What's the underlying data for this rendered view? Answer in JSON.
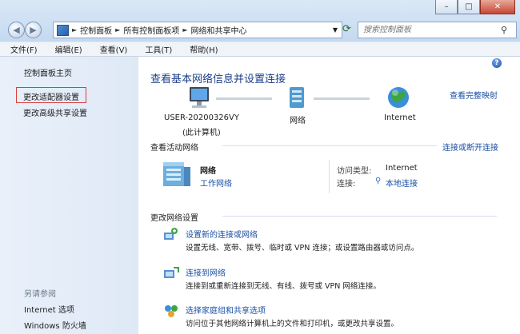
{
  "address": {
    "segments": [
      "控制面板",
      "所有控制面板项",
      "网络和共享中心"
    ]
  },
  "search": {
    "placeholder": "搜索控制面板"
  },
  "menu": [
    {
      "label": "文件(F)"
    },
    {
      "label": "编辑(E)"
    },
    {
      "label": "查看(V)"
    },
    {
      "label": "工具(T)"
    },
    {
      "label": "帮助(H)"
    }
  ],
  "sidebar": {
    "home": "控制面板主页",
    "adapter": "更改适配器设置",
    "sharing": "更改高级共享设置",
    "see_also": "另请参阅",
    "internet_options": "Internet 选项",
    "firewall": "Windows 防火墙"
  },
  "main": {
    "title": "查看基本网络信息并设置连接",
    "full_map": "查看完整映射",
    "computer_name": "USER-20200326VY",
    "computer_sub": "(此计算机)",
    "network_name": "网络",
    "internet_name": "Internet",
    "active_title": "查看活动网络",
    "connect_toggle": "连接或断开连接",
    "active_net_name": "网络",
    "active_net_type": "工作网络",
    "access_type_label": "访问类型:",
    "access_type_value": "Internet",
    "connection_label": "连接:",
    "connection_value": "本地连接",
    "change_title": "更改网络设置",
    "tasks": [
      {
        "title": "设置新的连接或网络",
        "desc": "设置无线、宽带、拨号、临时或 VPN 连接；或设置路由器或访问点。"
      },
      {
        "title": "连接到网络",
        "desc": "连接到或重新连接到无线、有线、拨号或 VPN 网络连接。"
      },
      {
        "title": "选择家庭组和共享选项",
        "desc": "访问位于其他网络计算机上的文件和打印机，或更改共享设置。"
      }
    ]
  }
}
